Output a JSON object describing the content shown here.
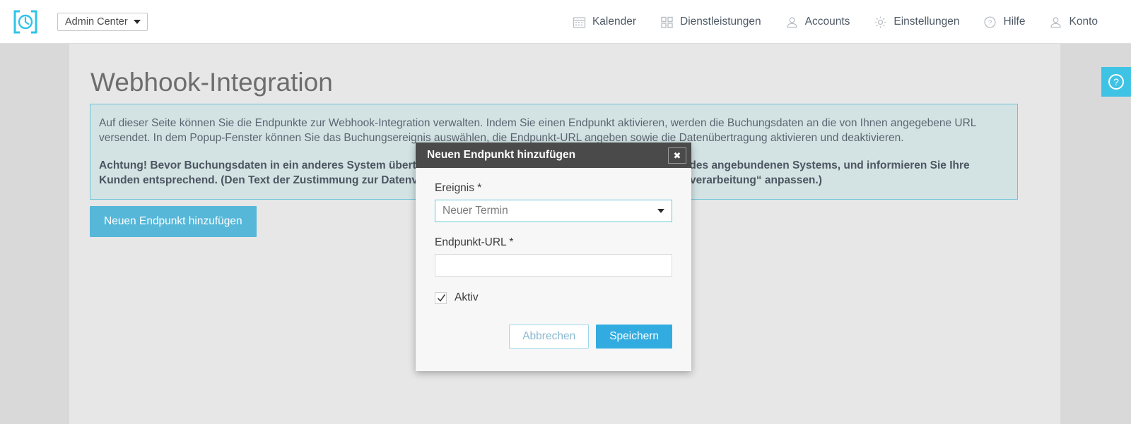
{
  "topbar": {
    "logo_name": "clock-bracket-logo",
    "brand_select": {
      "label": "Admin Center"
    },
    "nav": [
      {
        "label": "Kalender",
        "icon": "calendar-icon"
      },
      {
        "label": "Dienstleistungen",
        "icon": "grid-squares-icon"
      },
      {
        "label": "Accounts",
        "icon": "user-group-icon"
      },
      {
        "label": "Einstellungen",
        "icon": "gear-icon"
      },
      {
        "label": "Hilfe",
        "icon": "question-circle-icon"
      },
      {
        "label": "Konto",
        "icon": "user-icon"
      }
    ]
  },
  "page": {
    "title": "Webhook-Integration",
    "infobox": {
      "paragraph": "Auf dieser Seite können Sie die Endpunkte zur Webhook-Integration verwalten. Indem Sie einen Endpunkt aktivieren, werden die Buchungsdaten an die von Ihnen angegebene URL versendet. In dem Popup-Fenster können Sie das Buchungsereignis auswählen, die Endpunkt-URL angeben sowie die Datenübertragung aktivieren und deaktivieren.",
      "warning": "Achtung! Bevor Buchungsdaten in ein anderes System übertragen werden, prüfen Sie die Datenschutzrichtlinien des angebundenen Systems, und informieren Sie Ihre Kunden entsprechend. (Den Text der Zustimmung zur Datenverarbeitung können Sie unter „Einstellungen / Datenverarbeitung“ anpassen.)"
    },
    "add_endpoint_button": "Neuen Endpunkt hinzufügen",
    "help_button": {
      "icon": "question-circle-icon",
      "color": "#3fc3e4"
    }
  },
  "modal": {
    "title": "Neuen Endpunkt hinzufügen",
    "close_label": "✖",
    "close_icon": "close-icon",
    "fields": {
      "event": {
        "label": "Ereignis *",
        "value": "Neuer Termin",
        "options": [
          "Neuer Termin"
        ]
      },
      "url": {
        "label": "Endpunkt-URL *",
        "value": "",
        "placeholder": ""
      },
      "active": {
        "label": "Aktiv",
        "checked": true
      }
    },
    "buttons": {
      "cancel": "Abbrechen",
      "save": "Speichern"
    }
  },
  "colors": {
    "accent": "#56b7d9",
    "save_button": "#32ace0",
    "info_border": "#6cc4d8",
    "info_bg": "#d3e3e4",
    "modal_header": "#4a4a4a"
  }
}
